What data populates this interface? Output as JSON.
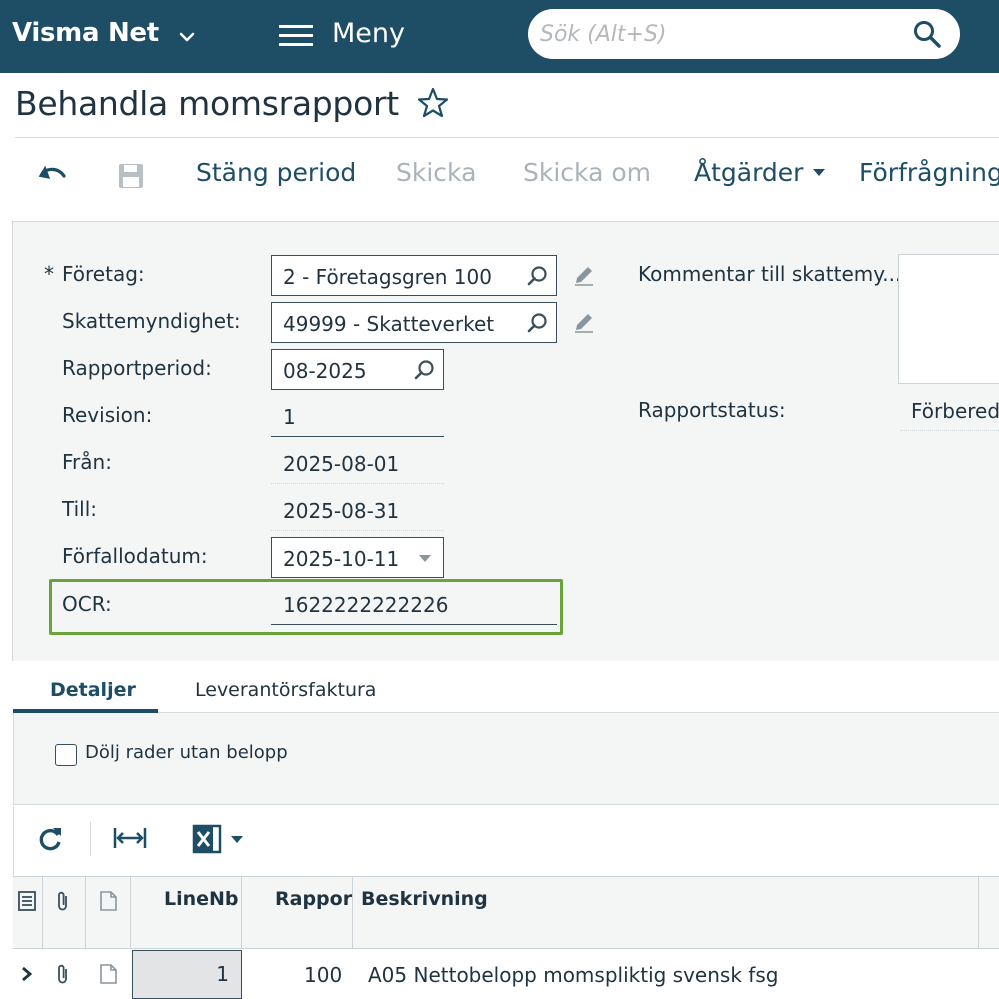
{
  "topbar": {
    "brand": "Visma Net",
    "menu_label": "Meny",
    "search_placeholder": "Sök (Alt+S)"
  },
  "page": {
    "title": "Behandla momsrapport"
  },
  "toolbar": {
    "close_period": "Stäng period",
    "send": "Skicka",
    "resend": "Skicka om",
    "actions": "Åtgärder",
    "inquiries": "Förfrågninga"
  },
  "form": {
    "required_marker": "*",
    "company": {
      "label": "Företag:",
      "value": "2 - Företagsgren 100"
    },
    "tax_agency": {
      "label": "Skattemyndighet:",
      "value": "49999 - Skatteverket"
    },
    "report_period": {
      "label": "Rapportperiod:",
      "value": "08-2025"
    },
    "revision": {
      "label": "Revision:",
      "value": "1"
    },
    "from": {
      "label": "Från:",
      "value": "2025-08-01"
    },
    "to": {
      "label": "Till:",
      "value": "2025-08-31"
    },
    "due_date": {
      "label": "Förfallodatum:",
      "value": "2025-10-11"
    },
    "ocr": {
      "label": "OCR:",
      "value": "1622222222226"
    },
    "comment": {
      "label": "Kommentar till skattemy...",
      "value": ""
    },
    "report_status": {
      "label": "Rapportstatus:",
      "value": "Förbered"
    }
  },
  "tabs": [
    {
      "label": "Detaljer",
      "active": true
    },
    {
      "label": "Leverantörsfaktura",
      "active": false
    }
  ],
  "filter": {
    "hide_zero_rows_label": "Dölj rader utan belopp",
    "hide_zero_rows_checked": false
  },
  "grid": {
    "columns": [
      "LineNb",
      "Rappor",
      "Beskrivning"
    ],
    "rows": [
      {
        "line_nb": "1",
        "report": "100",
        "description": "A05 Nettobelopp momspliktig svensk fsg"
      }
    ]
  },
  "colors": {
    "topbar": "#1d4e66",
    "highlight": "#6aa33a",
    "disabled_text": "#a9b3b9"
  },
  "icons": [
    "chevron-down-icon",
    "hamburger-icon",
    "search-icon",
    "star-icon",
    "undo-icon",
    "save-icon",
    "lookup-icon",
    "pencil-icon",
    "refresh-icon",
    "fit-columns-icon",
    "excel-icon",
    "notes-icon",
    "attachment-icon",
    "document-icon",
    "expand-row-icon"
  ]
}
